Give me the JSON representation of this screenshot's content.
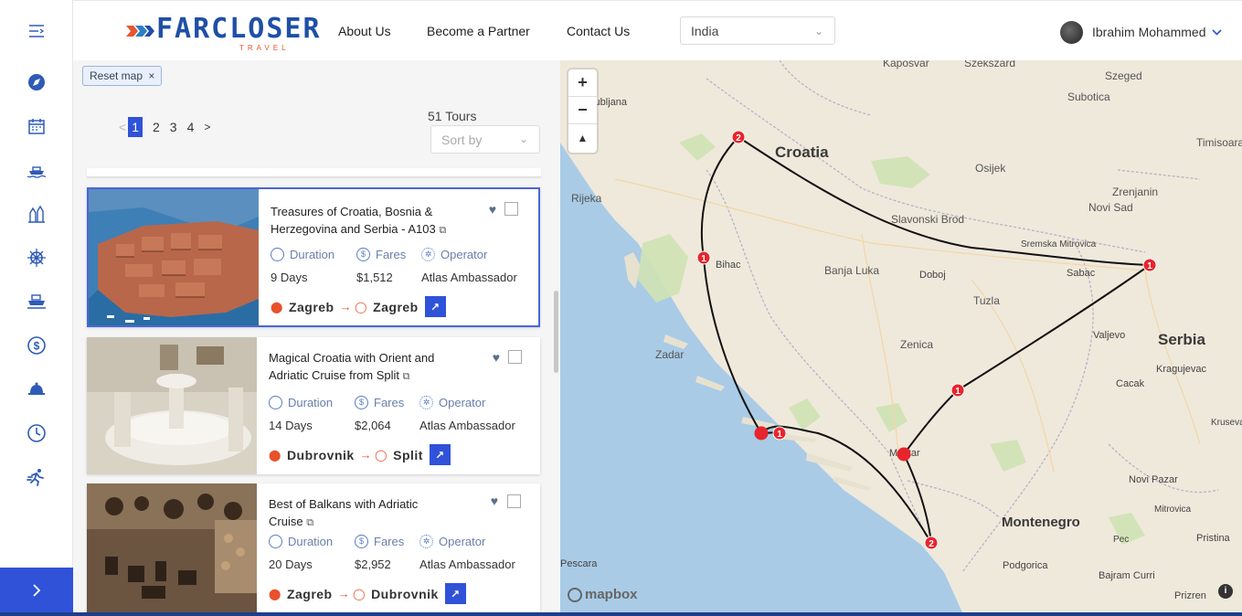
{
  "header": {
    "logo_text": "FARCLOSER",
    "logo_sub": "TRAVEL",
    "nav": [
      "About Us",
      "Become a Partner",
      "Contact Us"
    ],
    "country": "India",
    "user_name": "Ibrahim Mohammed"
  },
  "sidebar": {
    "icons": [
      "menu-icon",
      "compass-icon",
      "calendar-icon",
      "cruise-icon",
      "landmark-icon",
      "ship-wheel-icon",
      "ferry-icon",
      "dollar-icon",
      "bell-icon",
      "clock-icon",
      "runner-icon"
    ],
    "expand_icon": "chevron-right-icon"
  },
  "filters": {
    "reset_label": "Reset map",
    "pages": [
      "1",
      "2",
      "3",
      "4"
    ],
    "prev": "<",
    "next": ">",
    "tours_count": "51 Tours",
    "sort_placeholder": "Sort by"
  },
  "labels": {
    "duration": "Duration",
    "fares": "Fares",
    "operator": "Operator"
  },
  "tours": [
    {
      "title": "Treasures of Croatia, Bosnia & Herzegovina and Serbia - A103",
      "duration": "9 Days",
      "fare": "$1,512",
      "operator": "Atlas Ambassador",
      "from": "Zagreb",
      "to": "Zagreb"
    },
    {
      "title": "Magical Croatia with Orient and Adriatic Cruise from Split",
      "duration": "14 Days",
      "fare": "$2,064",
      "operator": "Atlas Ambassador",
      "from": "Dubrovnik",
      "to": "Split"
    },
    {
      "title": "Best of Balkans with Adriatic Cruise",
      "duration": "20 Days",
      "fare": "$2,952",
      "operator": "Atlas Ambassador",
      "from": "Zagreb",
      "to": "Dubrovnik"
    }
  ],
  "map": {
    "countries": [
      "Croatia",
      "Serbia",
      "Montenegro"
    ],
    "cities": [
      "Kaposvar",
      "Szekszard",
      "Szeged",
      "Subotica",
      "Timisoara",
      "Osijek",
      "Zrenjanin",
      "Novi Sad",
      "Slavonski Brod",
      "Sremska Mitrovica",
      "Sabac",
      "Banja Luka",
      "Doboj",
      "Rijeka",
      "Bihac",
      "Tuzla",
      "Zadar",
      "Zenica",
      "Valjevo",
      "Kragujevac",
      "Cacak",
      "Krusevac",
      "Mostar",
      "Novi Pazar",
      "Mitrovica",
      "Pristina",
      "Pec",
      "Podgorica",
      "Bajram Curri",
      "Prizren",
      "Pescara",
      "Ljubljana"
    ],
    "markers": [
      "2",
      "1",
      "1",
      "1",
      "1",
      "1",
      "2"
    ],
    "attribution": "mapbox",
    "zoom_in": "+",
    "zoom_out": "−",
    "compass": "▲"
  },
  "colors": {
    "accent": "#2f52d9",
    "marker": "#e8242c",
    "route": "#111111",
    "water": "#a9cbe6",
    "land": "#efe9dc"
  }
}
